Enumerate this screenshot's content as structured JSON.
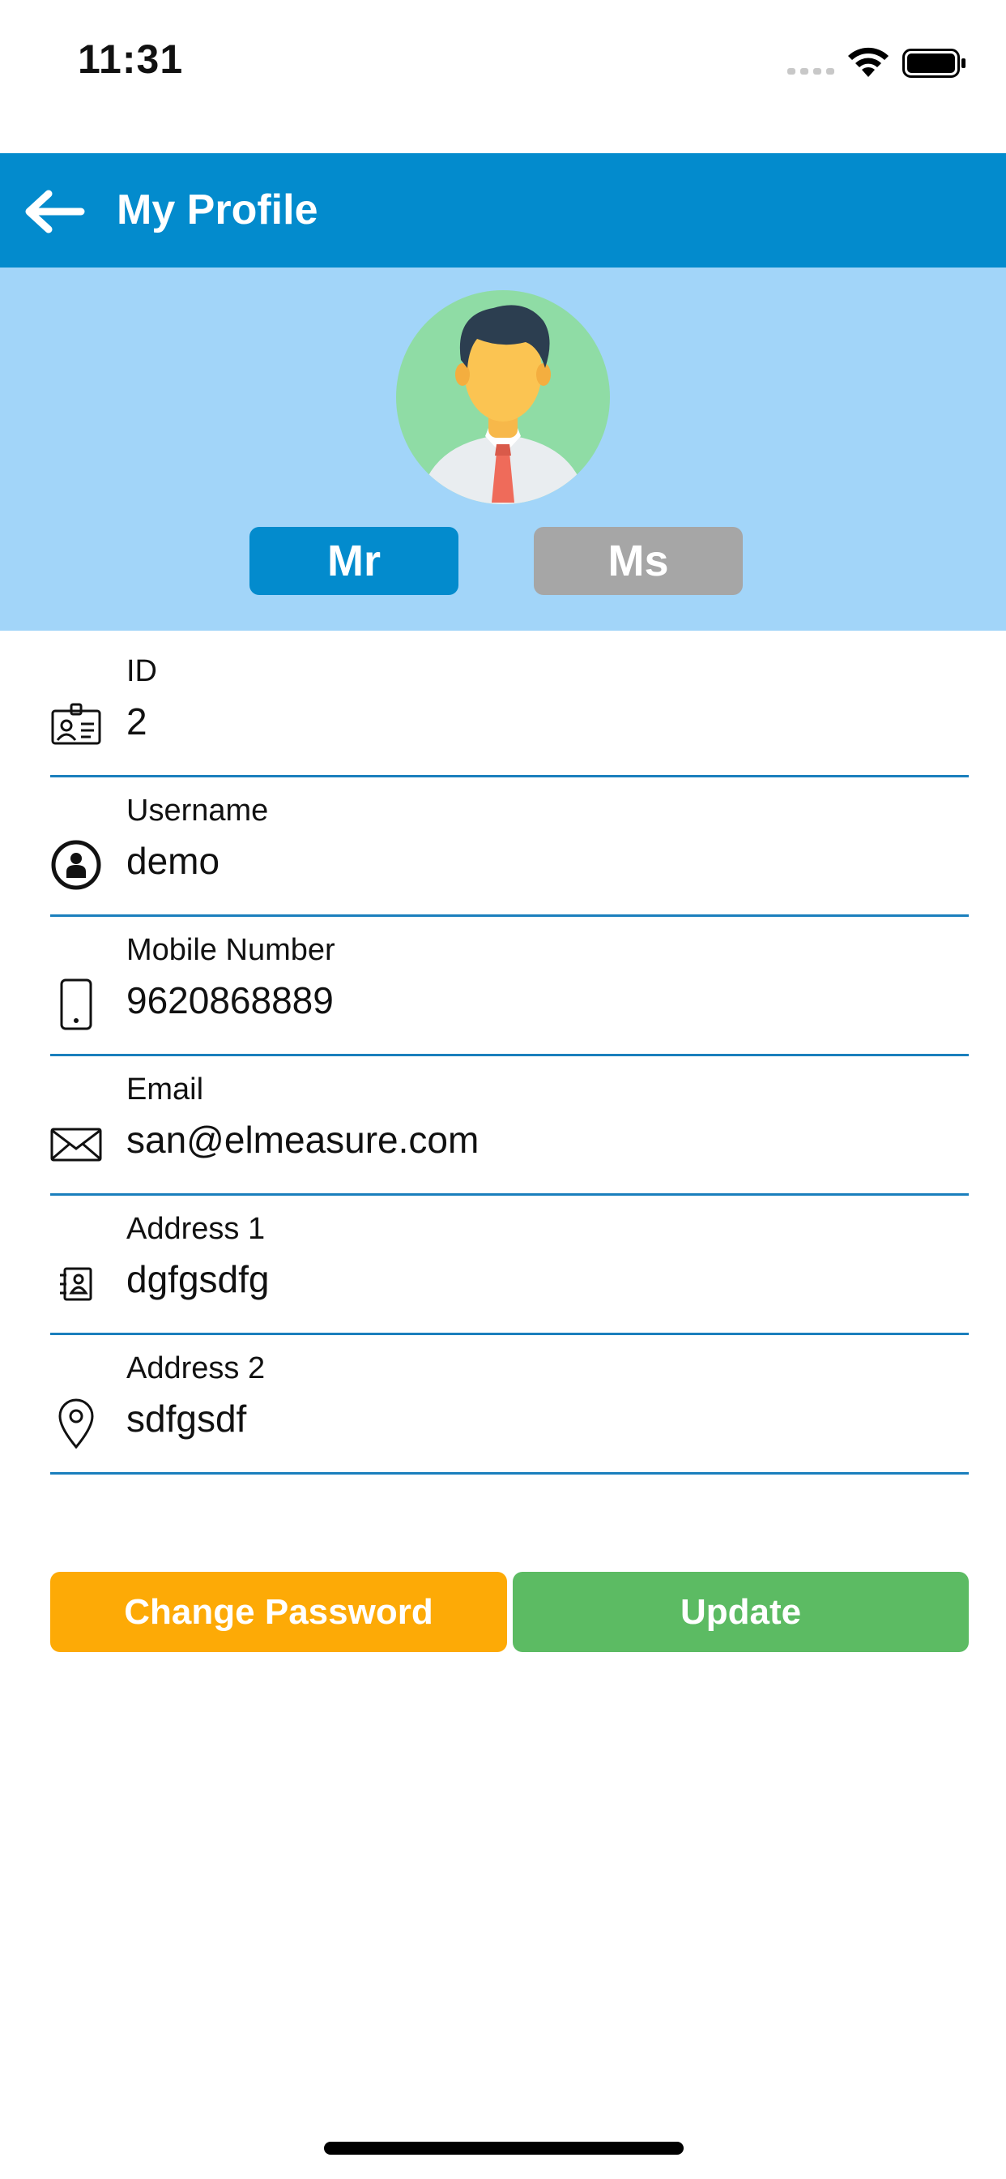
{
  "status_bar": {
    "time": "11:31"
  },
  "header": {
    "title": "My Profile"
  },
  "profile": {
    "title_options": [
      "Mr",
      "Ms"
    ],
    "selected_title": "Mr"
  },
  "fields": [
    {
      "label": "ID",
      "value": "2",
      "icon": "id-card-icon"
    },
    {
      "label": "Username",
      "value": "demo",
      "icon": "user-circle-icon"
    },
    {
      "label": "Mobile Number",
      "value": "9620868889",
      "icon": "mobile-phone-icon"
    },
    {
      "label": "Email",
      "value": "san@elmeasure.com",
      "icon": "envelope-icon"
    },
    {
      "label": "Address 1",
      "value": "dgfgsdfg",
      "icon": "address-book-icon"
    },
    {
      "label": "Address 2",
      "value": "sdfgsdf",
      "icon": "map-pin-icon"
    }
  ],
  "actions": {
    "change_password": "Change Password",
    "update": "Update"
  },
  "colors": {
    "header": "#038bcd",
    "banner": "#a2d5f9",
    "selected_toggle": "#038bcd",
    "unselected_toggle": "#a6a6a6",
    "change_password": "#fdaa06",
    "update": "#5cbb63",
    "underline": "#1a7fbd"
  }
}
